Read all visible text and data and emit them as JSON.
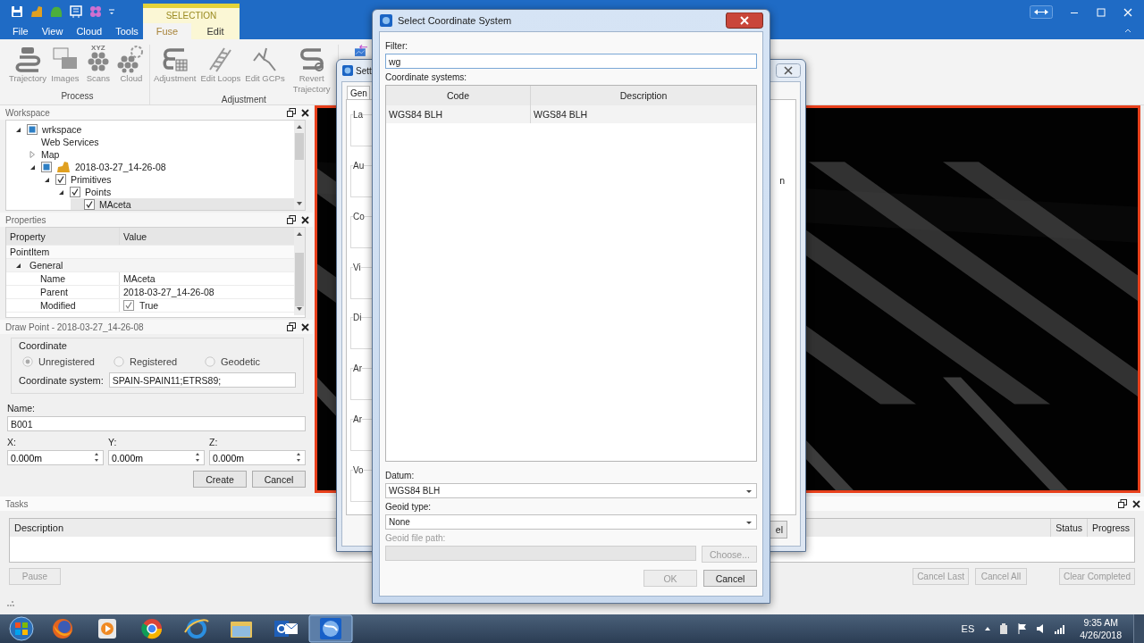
{
  "ribbon": {
    "tabs": [
      {
        "label": "File",
        "selected": false
      },
      {
        "label": "View",
        "selected": false
      },
      {
        "label": "Cloud",
        "selected": false
      },
      {
        "label": "Tools",
        "selected": false
      }
    ],
    "context": {
      "title": "SELECTION",
      "tabs": [
        {
          "label": "Fuse",
          "selected": true
        },
        {
          "label": "Edit",
          "selected": false
        }
      ]
    },
    "groups": [
      {
        "title": "Process",
        "buttons": [
          {
            "label": "Trajectory"
          },
          {
            "label": "Images"
          },
          {
            "label": "Scans",
            "icon_text": "XYZ"
          },
          {
            "label": "Cloud"
          }
        ]
      },
      {
        "title": "Adjustment",
        "buttons": [
          {
            "label": "Adjustment"
          },
          {
            "label": "Edit Loops"
          },
          {
            "label": "Edit GCPs"
          },
          {
            "label": "Revert Trajectory"
          }
        ]
      }
    ]
  },
  "workspace": {
    "title": "Workspace",
    "tree": [
      {
        "label": "wrkspace",
        "expanded": true,
        "partial": true,
        "selected": false,
        "children": [
          {
            "label": "Web Services",
            "selected": false
          },
          {
            "label": "Map",
            "expanded": false,
            "selected": false
          },
          {
            "label": "2018-03-27_14-26-08",
            "kind": "dataset",
            "expanded": true,
            "partial": true,
            "selected": false,
            "children": [
              {
                "label": "Primitives",
                "expanded": true,
                "checked": true,
                "partial": false,
                "selected": false,
                "children": [
                  {
                    "label": "Points",
                    "expanded": true,
                    "checked": true,
                    "partial": false,
                    "selected": false,
                    "children": [
                      {
                        "label": "MAceta",
                        "checked": true,
                        "partial": false,
                        "selected": true
                      }
                    ]
                  }
                ]
              }
            ]
          }
        ]
      }
    ]
  },
  "properties": {
    "title": "Properties",
    "columns": [
      "Property",
      "Value"
    ],
    "rows": [
      {
        "kind": "category",
        "label": "PointItem"
      },
      {
        "kind": "group",
        "label": "General",
        "expanded": true
      },
      {
        "kind": "value",
        "name": "Name",
        "value": "MAceta"
      },
      {
        "kind": "value",
        "name": "Parent",
        "value": "2018-03-27_14-26-08"
      },
      {
        "kind": "check",
        "name": "Modified",
        "value": "True",
        "checked": true
      }
    ]
  },
  "draw_point": {
    "title": "Draw Point - 2018-03-27_14-26-08",
    "group_title": "Coordinate",
    "modes": [
      {
        "label": "Unregistered",
        "selected": true
      },
      {
        "label": "Registered",
        "selected": false
      },
      {
        "label": "Geodetic",
        "selected": false
      }
    ],
    "coordinate_system_label": "Coordinate system:",
    "coordinate_system": "SPAIN-SPAIN11;ETRS89;",
    "name_label": "Name:",
    "name": "B001",
    "coords": [
      {
        "label": "X:",
        "value": "0.000m"
      },
      {
        "label": "Y:",
        "value": "0.000m"
      },
      {
        "label": "Z:",
        "value": "0.000m"
      }
    ],
    "buttons": [
      "Create",
      "Cancel"
    ]
  },
  "tasks": {
    "title": "Tasks",
    "columns": [
      "Description",
      "Status",
      "Progress"
    ],
    "buttons": [
      {
        "label": "Pause",
        "disabled": true
      },
      {
        "label": "Cancel Last",
        "disabled": true
      },
      {
        "label": "Cancel All",
        "disabled": true
      },
      {
        "label": "Clear Completed",
        "disabled": true
      }
    ]
  },
  "settings_dialog": {
    "title": "Sett",
    "tab": "Gen",
    "left_fragments": [
      "La",
      "Au",
      "Co",
      "Vi",
      "Di",
      "Ar",
      "Ar",
      "Vo"
    ],
    "right_fragments": [
      "n",
      "el"
    ]
  },
  "select_dialog": {
    "title": "Select Coordinate System",
    "filter_label": "Filter:",
    "filter": "wg",
    "list_label": "Coordinate systems:",
    "columns": [
      "Code",
      "Description"
    ],
    "rows": [
      {
        "code": "WGS84 BLH",
        "description": "WGS84 BLH",
        "selected": true
      }
    ],
    "datum_label": "Datum:",
    "datum": "WGS84 BLH",
    "geoid_label": "Geoid type:",
    "geoid": "None",
    "path_label": "Geoid file path:",
    "path_disabled": true,
    "choose": "Choose...",
    "buttons": [
      {
        "label": "OK",
        "disabled": true
      },
      {
        "label": "Cancel",
        "disabled": false
      }
    ]
  },
  "taskbar": {
    "apps": [
      {
        "active": false
      },
      {
        "active": false
      },
      {
        "active": false
      },
      {
        "active": false
      },
      {
        "active": false
      },
      {
        "active": false
      },
      {
        "active": true
      }
    ],
    "language": "ES",
    "time": "9:35 AM",
    "date": "4/26/2018"
  }
}
